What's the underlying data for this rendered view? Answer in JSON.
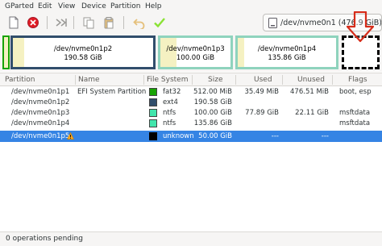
{
  "menubar": {
    "items": [
      "GParted",
      "Edit",
      "View",
      "Device",
      "Partition",
      "Help"
    ]
  },
  "toolbar": {
    "icons": [
      "new-icon",
      "delete-icon",
      "resize-move-icon",
      "copy-icon",
      "paste-icon",
      "undo-icon",
      "apply-icon"
    ]
  },
  "device_selector": {
    "label": "/dev/nvme0n1 (476.9 GiB)"
  },
  "disk_map": {
    "partitions": [
      {
        "name": "/dev/nvme0n1p2",
        "size": "190.58 GiB",
        "filesystem": "ext4"
      },
      {
        "name": "/dev/nvme0n1p3",
        "size": "100.00 GiB",
        "filesystem": "ntfs"
      },
      {
        "name": "/dev/nvme0n1p4",
        "size": "135.86 GiB",
        "filesystem": "ntfs"
      }
    ]
  },
  "table": {
    "headers": {
      "partition": "Partition",
      "name": "Name",
      "filesystem": "File System",
      "size": "Size",
      "used": "Used",
      "unused": "Unused",
      "flags": "Flags"
    },
    "rows": [
      {
        "partition": "/dev/nvme0n1p1",
        "name": "EFI System Partition",
        "filesystem": "fat32",
        "fs_color": "#18a303",
        "size": "512.00 MiB",
        "used": "35.49 MiB",
        "unused": "476.51 MiB",
        "flags": "boot, esp"
      },
      {
        "partition": "/dev/nvme0n1p2",
        "name": "",
        "filesystem": "ext4",
        "fs_color": "#314e6c",
        "size": "190.58 GiB",
        "used": "",
        "unused": "",
        "flags": ""
      },
      {
        "partition": "/dev/nvme0n1p3",
        "name": "",
        "filesystem": "ntfs",
        "fs_color": "#42e5ac",
        "size": "100.00 GiB",
        "used": "77.89 GiB",
        "unused": "22.11 GiB",
        "flags": "msftdata"
      },
      {
        "partition": "/dev/nvme0n1p4",
        "name": "",
        "filesystem": "ntfs",
        "fs_color": "#42e5ac",
        "size": "135.86 GiB",
        "used": "",
        "unused": "",
        "flags": "msftdata"
      },
      {
        "partition": "/dev/nvme0n1p5",
        "name": "",
        "filesystem": "unknown",
        "fs_color": "#000000",
        "size": "50.00 GiB",
        "used": "---",
        "unused": "---",
        "flags": "",
        "selected": true,
        "warning": true
      }
    ]
  },
  "status": {
    "text": "0 operations pending"
  },
  "colors": {
    "selection": "#3584e4",
    "annotation_arrow": "#d62c1a",
    "ext4_border": "#314e6c",
    "ntfs_border": "#8fd3bd",
    "used_fill": "#f5f1c2"
  }
}
